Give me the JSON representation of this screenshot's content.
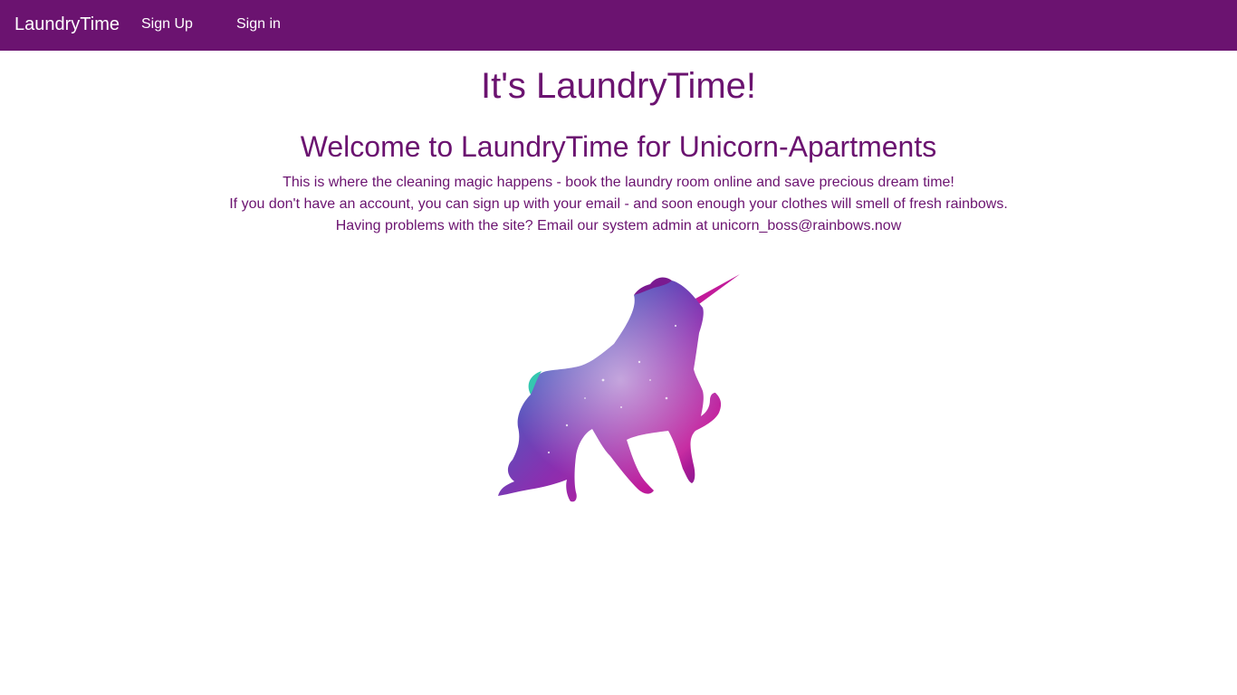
{
  "navbar": {
    "brand": "LaundryTime",
    "links": [
      {
        "label": "Sign Up"
      },
      {
        "label": "Sign in"
      }
    ],
    "background_color": "#6b1370"
  },
  "main": {
    "title": "It's LaundryTime!",
    "subtitle": "Welcome to LaundryTime for Unicorn-Apartments",
    "lines": [
      "This is where the cleaning magic happens - book the laundry room online and save precious dream time!",
      "If you don't have an account, you can sign up with your email - and soon enough your clothes will smell of fresh rainbows.",
      "Having problems with the site? Email our system admin at unicorn_boss@rainbows.now"
    ],
    "text_color": "#6b1370",
    "image_icon": "unicorn-image"
  }
}
